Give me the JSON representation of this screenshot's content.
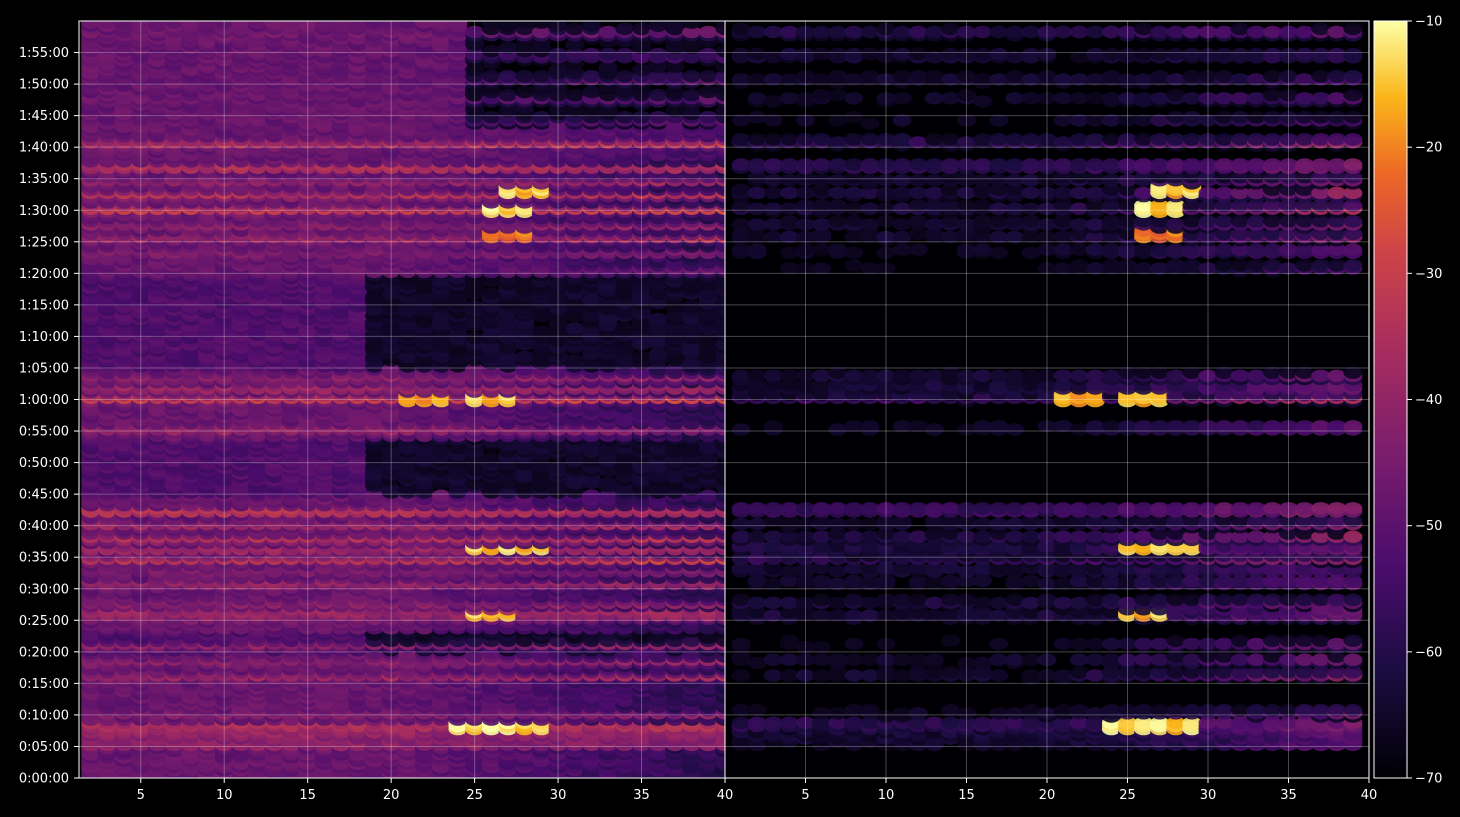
{
  "chart_data": {
    "type": "heatmap",
    "colormap": "inferno",
    "background": "#000000",
    "grid": true,
    "colorbar": {
      "min": -70,
      "max": -10,
      "ticks": [
        -10,
        -20,
        -30,
        -40,
        -50,
        -60,
        -70
      ],
      "tick_labels": [
        "−10",
        "−20",
        "−30",
        "−40",
        "−50",
        "−60",
        "−70"
      ],
      "position": "right"
    },
    "y_axis": {
      "range_seconds": [
        0,
        7200
      ],
      "tick_seconds": [
        0,
        300,
        600,
        900,
        1200,
        1500,
        1800,
        2100,
        2400,
        2700,
        3000,
        3300,
        3600,
        3900,
        4200,
        4500,
        4800,
        5100,
        5400,
        5700,
        6000,
        6300,
        6600,
        6900
      ],
      "tick_labels": [
        "0:00:00",
        "0:05:00",
        "0:10:00",
        "0:15:00",
        "0:20:00",
        "0:25:00",
        "0:30:00",
        "0:35:00",
        "0:40:00",
        "0:45:00",
        "0:50:00",
        "0:55:00",
        "1:00:00",
        "1:05:00",
        "1:10:00",
        "1:15:00",
        "1:20:00",
        "1:25:00",
        "1:30:00",
        "1:35:00",
        "1:40:00",
        "1:45:00",
        "1:50:00",
        "1:55:00"
      ]
    },
    "panels": [
      {
        "name": "",
        "x_range": [
          1.3,
          40
        ],
        "x_ticks": [
          5,
          10,
          15,
          20,
          25,
          30,
          35,
          40
        ],
        "x_tick_labels": [
          "5",
          "10",
          "15",
          "20",
          "25",
          "30",
          "35",
          "40"
        ],
        "columns": [
          2,
          40
        ]
      },
      {
        "name": "",
        "x_range": [
          0,
          40
        ],
        "x_ticks": [
          5,
          10,
          15,
          20,
          25,
          30,
          35,
          40
        ],
        "x_tick_labels": [
          "5",
          "10",
          "15",
          "20",
          "25",
          "30",
          "35",
          "40"
        ],
        "columns": [
          1,
          39
        ]
      }
    ],
    "bands": [
      {
        "t": 510,
        "base_left": -33,
        "base_right": -55,
        "peak": -15
      },
      {
        "t": 450,
        "base_left": -38,
        "base_right": -60,
        "peak": -28
      },
      {
        "t": 390,
        "base_left": -42,
        "base_right": -62,
        "peak": -30
      },
      {
        "t": 330,
        "base_left": -40,
        "base_right": -64,
        "peak": -32
      },
      {
        "t": 620,
        "base_left": -45,
        "base_right": -66,
        "peak": -38
      },
      {
        "t": 980,
        "base_left": -40,
        "base_right": -64,
        "peak": -34
      },
      {
        "t": 1120,
        "base_left": -44,
        "base_right": -65,
        "peak": -35
      },
      {
        "t": 1270,
        "base_left": -42,
        "base_right": -68,
        "peak": -36
      },
      {
        "t": 1590,
        "base_left": -38,
        "base_right": -66,
        "peak": -22
      },
      {
        "t": 1670,
        "base_left": -44,
        "base_right": -62,
        "peak": -38
      },
      {
        "t": 1540,
        "base_left": -44,
        "base_right": -62,
        "peak": -35
      },
      {
        "t": 1860,
        "base_left": -40,
        "base_right": -64,
        "peak": -27
      },
      {
        "t": 1980,
        "base_left": -46,
        "base_right": -62,
        "peak": -36
      },
      {
        "t": 2090,
        "base_left": -35,
        "base_right": -58,
        "peak": -19
      },
      {
        "t": 2190,
        "base_left": -37,
        "base_right": -58,
        "peak": -24
      },
      {
        "t": 2290,
        "base_left": -36,
        "base_right": -60,
        "peak": -28
      },
      {
        "t": 2420,
        "base_left": -40,
        "base_right": -64,
        "peak": -34
      },
      {
        "t": 2550,
        "base_left": -30,
        "base_right": -50,
        "peak": -25
      },
      {
        "t": 3330,
        "base_left": -40,
        "base_right": -66,
        "peak": -38
      },
      {
        "t": 3620,
        "base_left": -32,
        "base_right": -55,
        "peak": -20
      },
      {
        "t": 3720,
        "base_left": -38,
        "base_right": -60,
        "peak": -28
      },
      {
        "t": 3820,
        "base_left": -44,
        "base_right": -63,
        "peak": -36
      },
      {
        "t": 4850,
        "base_left": -52,
        "base_right": -68,
        "peak": -42
      },
      {
        "t": 5010,
        "base_left": -45,
        "base_right": -65,
        "peak": -38
      },
      {
        "t": 5150,
        "base_left": -40,
        "base_right": -64,
        "peak": -26
      },
      {
        "t": 5270,
        "base_left": -44,
        "base_right": -64,
        "peak": -34
      },
      {
        "t": 5420,
        "base_left": -32,
        "base_right": -62,
        "peak": -16
      },
      {
        "t": 5560,
        "base_left": -36,
        "base_right": -62,
        "peak": -28
      },
      {
        "t": 5690,
        "base_left": -42,
        "base_right": -64,
        "peak": -30
      },
      {
        "t": 5820,
        "base_left": -32,
        "base_right": -55,
        "peak": -23
      },
      {
        "t": 6050,
        "base_left": -36,
        "base_right": -58,
        "peak": -25
      },
      {
        "t": 6260,
        "base_left": -52,
        "base_right": -66,
        "peak": -48
      },
      {
        "t": 6460,
        "base_left": -52,
        "base_right": -66,
        "peak": -48
      },
      {
        "t": 6650,
        "base_left": -54,
        "base_right": -64,
        "peak": -46
      },
      {
        "t": 6870,
        "base_left": -54,
        "base_right": -62,
        "peak": -46
      },
      {
        "t": 7090,
        "base_left": -48,
        "base_right": -60,
        "peak": -44
      }
    ],
    "quiet_gaps_seconds": [
      [
        1200,
        1400
      ],
      [
        2700,
        3240
      ],
      [
        3900,
        4800
      ]
    ],
    "hotspots": [
      {
        "t": 5410,
        "x": 27,
        "v": -15
      },
      {
        "t": 5590,
        "x": 28,
        "v": -18
      },
      {
        "t": 2190,
        "x": 28,
        "v": -17
      },
      {
        "t": 2190,
        "x": 26,
        "v": -19
      },
      {
        "t": 500,
        "x": 25,
        "v": -14
      },
      {
        "t": 500,
        "x": 28,
        "v": -16
      },
      {
        "t": 3620,
        "x": 26,
        "v": -18
      },
      {
        "t": 3620,
        "x": 22,
        "v": -21
      },
      {
        "t": 1560,
        "x": 26,
        "v": -19
      },
      {
        "t": 5170,
        "x": 27,
        "v": -27
      }
    ]
  }
}
